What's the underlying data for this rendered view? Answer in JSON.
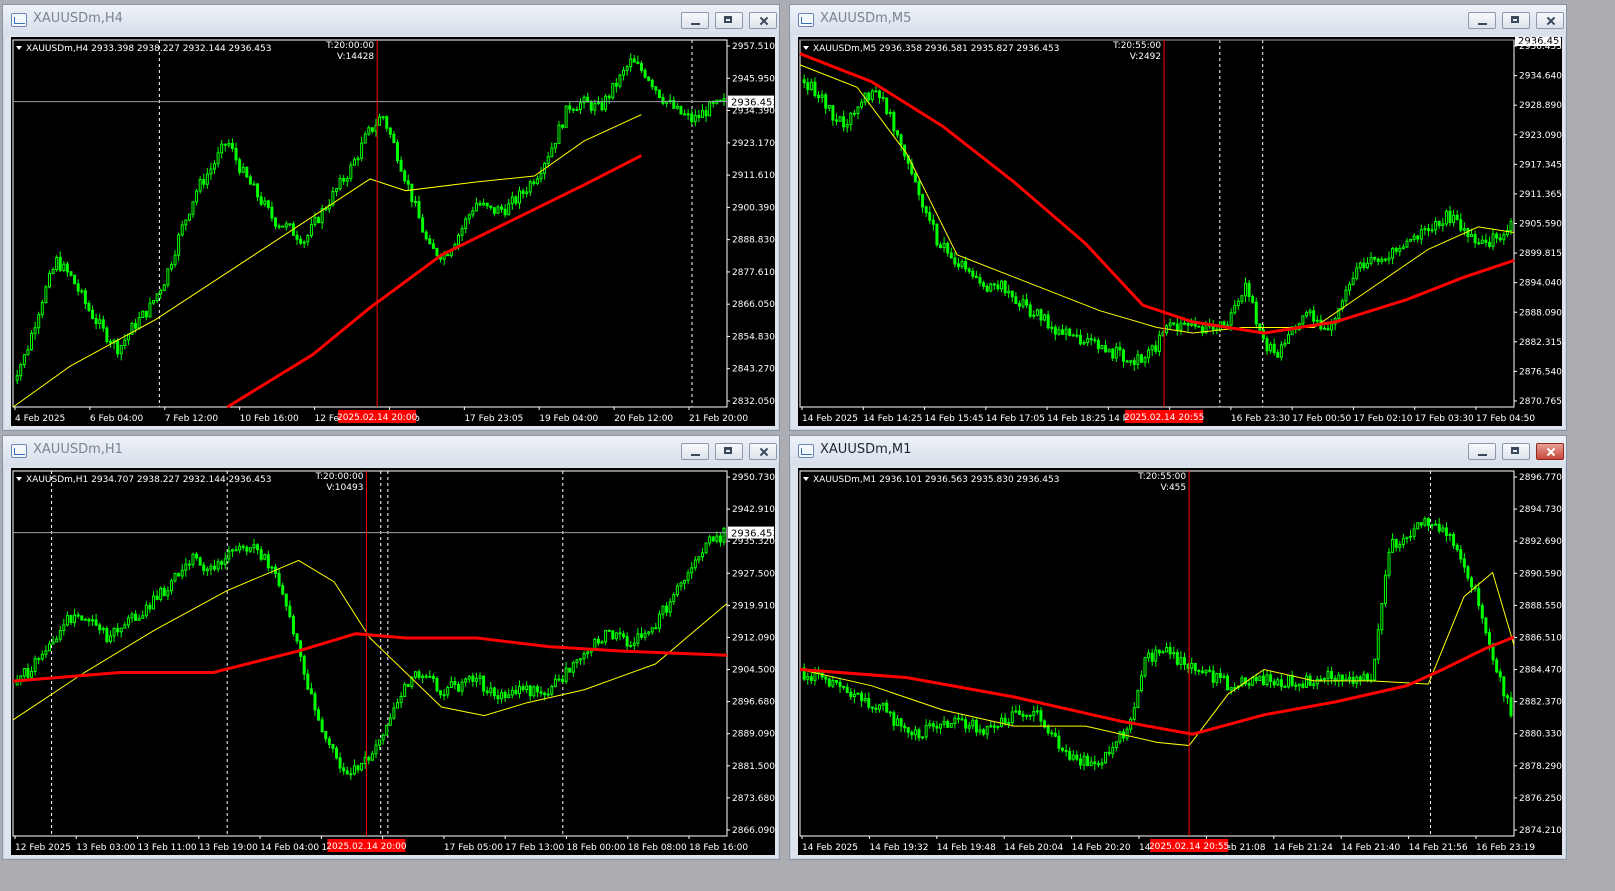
{
  "colors": {
    "bull": "#00ff00",
    "bear": "#00ff00",
    "ma_fast": "#ffff00",
    "ma_slow": "#ff0000",
    "crosshair": "#ff0000",
    "grid_separator": "#ffffff",
    "axis_text": "#ffffff"
  },
  "windows": [
    {
      "title": "XAUUSDm,H4",
      "active": false,
      "buttons": [
        "minimize",
        "maximize",
        "close"
      ],
      "chart_data": {
        "type": "candlestick",
        "symbol_line": "XAUUSDm,H4  2933.398 2938.227 2932.144 2936.453",
        "crosshair_time": "T:20:00:00",
        "crosshair_volume": "V:14428",
        "y_ticks": [
          "2957.510",
          "2945.950",
          "2934.390",
          "2923.170",
          "2911.610",
          "2900.390",
          "2888.830",
          "2877.610",
          "2866.050",
          "2854.830",
          "2843.270",
          "2832.050"
        ],
        "ylim": [
          2832.05,
          2957.51
        ],
        "x_ticks": [
          "4 Feb 2025",
          "6 Feb 04:00",
          "7 Feb 12:00",
          "10 Feb 16:00",
          "12 Feb 00:00",
          "13 Feb",
          "17 Feb 23:05",
          "19 Feb 04:00",
          "20 Feb 12:00",
          "21 Feb 20:00"
        ],
        "crosshair_date_label": "2025.02.14 20:00",
        "current_price": "2936.453",
        "close_path": [
          2840,
          2850,
          2868,
          2882,
          2876,
          2866,
          2858,
          2852,
          2860,
          2866,
          2876,
          2892,
          2906,
          2914,
          2923,
          2912,
          2904,
          2896,
          2893,
          2889,
          2898,
          2906,
          2914,
          2925,
          2932,
          2918,
          2902,
          2886,
          2884,
          2892,
          2902,
          2899,
          2900,
          2905,
          2912,
          2922,
          2935,
          2936,
          2934,
          2942,
          2950,
          2946,
          2938,
          2933,
          2930,
          2934,
          2936
        ],
        "crosshair_fraction": 0.51,
        "separator_fractions": [
          0.205,
          0.951
        ],
        "ma_fast": [
          [
            0,
            2832
          ],
          [
            0.08,
            2846
          ],
          [
            0.2,
            2862
          ],
          [
            0.35,
            2886
          ],
          [
            0.5,
            2910
          ],
          [
            0.55,
            2906
          ],
          [
            0.65,
            2909
          ],
          [
            0.73,
            2911
          ],
          [
            0.8,
            2923
          ],
          [
            0.88,
            2932
          ]
        ],
        "ma_slow": [
          [
            0.3,
            2832
          ],
          [
            0.42,
            2850
          ],
          [
            0.5,
            2866
          ],
          [
            0.6,
            2884
          ],
          [
            0.7,
            2896
          ],
          [
            0.8,
            2908
          ],
          [
            0.88,
            2918
          ]
        ]
      }
    },
    {
      "title": "XAUUSDm,M5",
      "active": false,
      "buttons": [
        "minimize",
        "maximize",
        "close"
      ],
      "chart_data": {
        "type": "candlestick",
        "symbol_line": "XAUUSDm,M5  2936.358 2936.581 2935.827 2936.453",
        "crosshair_time": "T:20:55:00",
        "crosshair_volume": "V:2492",
        "y_ticks": [
          "2936.453",
          "2934.640",
          "2928.890",
          "2923.090",
          "2917.345",
          "2911.365",
          "2905.590",
          "2899.815",
          "2894.040",
          "2888.090",
          "2882.315",
          "2876.540",
          "2870.765"
        ],
        "ylim": [
          2870.765,
          2936.453
        ],
        "x_ticks": [
          "14 Feb 2025",
          "14 Feb 14:25",
          "14 Feb 15:45",
          "14 Feb 17:05",
          "14 Feb 18:25",
          "14 Feb",
          "21:05",
          "16 Feb 23:30",
          "17 Feb 00:50",
          "17 Feb 02:10",
          "17 Feb 03:30",
          "17 Feb 04:50"
        ],
        "crosshair_date_label": "2025.02.14 20:55",
        "current_price": "2936.453",
        "close_path": [
          2930,
          2928,
          2924,
          2921,
          2925,
          2928,
          2923,
          2916,
          2908,
          2901,
          2897,
          2895,
          2892,
          2893,
          2890,
          2888,
          2886,
          2884,
          2883,
          2882,
          2881,
          2880,
          2879,
          2881,
          2886,
          2885,
          2884,
          2885,
          2887,
          2893,
          2882,
          2880,
          2885,
          2887,
          2884,
          2889,
          2895,
          2897,
          2898,
          2899,
          2901,
          2903,
          2905,
          2903,
          2900,
          2901,
          2903
        ],
        "crosshair_fraction": 0.51,
        "separator_fractions": [
          0.588,
          0.648
        ],
        "ma_fast": [
          [
            0,
            2932
          ],
          [
            0.08,
            2928
          ],
          [
            0.15,
            2916
          ],
          [
            0.22,
            2898
          ],
          [
            0.3,
            2894
          ],
          [
            0.42,
            2888
          ],
          [
            0.5,
            2885
          ],
          [
            0.55,
            2884
          ],
          [
            0.62,
            2885
          ],
          [
            0.72,
            2885
          ],
          [
            0.8,
            2892
          ],
          [
            0.88,
            2899
          ],
          [
            0.95,
            2903
          ],
          [
            1,
            2902
          ]
        ],
        "ma_slow": [
          [
            0,
            2934
          ],
          [
            0.1,
            2929
          ],
          [
            0.2,
            2921
          ],
          [
            0.3,
            2911
          ],
          [
            0.4,
            2900
          ],
          [
            0.48,
            2889
          ],
          [
            0.55,
            2886
          ],
          [
            0.65,
            2884
          ],
          [
            0.75,
            2886
          ],
          [
            0.85,
            2890
          ],
          [
            0.93,
            2894
          ],
          [
            1,
            2897
          ]
        ]
      }
    },
    {
      "title": "XAUUSDm,H1",
      "active": false,
      "buttons": [
        "minimize",
        "maximize",
        "close"
      ],
      "chart_data": {
        "type": "candlestick",
        "symbol_line": "XAUUSDm,H1  2934.707 2938.227 2932.144 2936.453",
        "crosshair_time": "T:20:00:00",
        "crosshair_volume": "V:10493",
        "y_ticks": [
          "2950.730",
          "2942.910",
          "2935.320",
          "2927.500",
          "2919.910",
          "2912.090",
          "2904.500",
          "2896.680",
          "2889.090",
          "2881.500",
          "2873.680",
          "2866.090"
        ],
        "ylim": [
          2866.09,
          2950.73
        ],
        "x_ticks": [
          "12 Feb 2025",
          "13 Feb 03:00",
          "13 Feb 11:00",
          "13 Feb 19:00",
          "14 Feb 04:00",
          "14 Feb",
          "00",
          "17 Feb 05:00",
          "17 Feb 13:00",
          "18 Feb 00:00",
          "18 Feb 08:00",
          "18 Feb 16:00"
        ],
        "crosshair_date_label": "2025.02.14 20:00",
        "current_price": "2936.453",
        "close_path": [
          2900,
          2904,
          2908,
          2914,
          2918,
          2916,
          2912,
          2916,
          2918,
          2922,
          2926,
          2930,
          2928,
          2930,
          2934,
          2932,
          2926,
          2915,
          2900,
          2888,
          2882,
          2881,
          2886,
          2894,
          2902,
          2904,
          2900,
          2901,
          2903,
          2899,
          2898,
          2900,
          2899,
          2902,
          2906,
          2910,
          2913,
          2911,
          2912,
          2916,
          2922,
          2928,
          2934,
          2936
        ],
        "crosshair_fraction": 0.495,
        "separator_fractions": [
          0.054,
          0.3,
          0.515,
          0.525,
          0.77
        ],
        "ma_fast": [
          [
            0,
            2893
          ],
          [
            0.1,
            2904
          ],
          [
            0.2,
            2914
          ],
          [
            0.3,
            2923
          ],
          [
            0.4,
            2930
          ],
          [
            0.45,
            2925
          ],
          [
            0.5,
            2912
          ],
          [
            0.6,
            2896
          ],
          [
            0.66,
            2894
          ],
          [
            0.72,
            2897
          ],
          [
            0.8,
            2900
          ],
          [
            0.9,
            2906
          ],
          [
            1,
            2920
          ]
        ],
        "ma_slow": [
          [
            0,
            2902
          ],
          [
            0.15,
            2904
          ],
          [
            0.28,
            2904
          ],
          [
            0.4,
            2909
          ],
          [
            0.48,
            2913
          ],
          [
            0.55,
            2912
          ],
          [
            0.65,
            2912
          ],
          [
            0.75,
            2910
          ],
          [
            0.85,
            2909
          ],
          [
            1,
            2908
          ]
        ]
      }
    },
    {
      "title": "XAUUSDm,M1",
      "active": true,
      "buttons": [
        "minimize",
        "maximize",
        "close"
      ],
      "chart_data": {
        "type": "candlestick",
        "symbol_line": "XAUUSDm,M1  2936.101 2936.563 2935.830 2936.453",
        "crosshair_time": "T:20:55:00",
        "crosshair_volume": "V:455",
        "y_ticks": [
          "2896.770",
          "2894.730",
          "2892.690",
          "2890.590",
          "2888.550",
          "2886.510",
          "2884.470",
          "2882.370",
          "2880.330",
          "2878.290",
          "2876.250",
          "2874.210"
        ],
        "ylim": [
          2874.21,
          2896.77
        ],
        "x_ticks": [
          "14 Feb 2025",
          "14 Feb 19:32",
          "14 Feb 19:48",
          "14 Feb 20:04",
          "14 Feb 20:20",
          "14 Feb 2",
          "14 Feb 21:08",
          "14 Feb 21:24",
          "14 Feb 21:40",
          "14 Feb 21:56",
          "16 Feb 23:19"
        ],
        "crosshair_date_label": "2025.02.14 20:55",
        "current_price": "2936.453",
        "close_path": [
          2884.5,
          2884,
          2883.5,
          2883,
          2882.5,
          2882,
          2881,
          2880.5,
          2881,
          2881.2,
          2881,
          2880.8,
          2881.5,
          2882,
          2881.5,
          2880,
          2879,
          2878.5,
          2879.5,
          2881,
          2885,
          2886,
          2885,
          2884.5,
          2884,
          2883.5,
          2883.8,
          2884,
          2883.8,
          2883.6,
          2884,
          2884.2,
          2883.8,
          2884,
          2892,
          2893,
          2893.5,
          2893,
          2892,
          2889,
          2885,
          2882
        ],
        "crosshair_fraction": 0.545,
        "separator_fractions": [
          0.883
        ],
        "ma_fast": [
          [
            0,
            2884.5
          ],
          [
            0.1,
            2883.5
          ],
          [
            0.2,
            2882
          ],
          [
            0.3,
            2881
          ],
          [
            0.4,
            2881
          ],
          [
            0.5,
            2880
          ],
          [
            0.545,
            2879.8
          ],
          [
            0.6,
            2883
          ],
          [
            0.65,
            2884.5
          ],
          [
            0.72,
            2883.8
          ],
          [
            0.8,
            2883.8
          ],
          [
            0.88,
            2883.6
          ],
          [
            0.93,
            2889
          ],
          [
            0.97,
            2890.5
          ],
          [
            1,
            2886
          ]
        ],
        "ma_slow": [
          [
            0,
            2884.5
          ],
          [
            0.15,
            2884
          ],
          [
            0.3,
            2882.8
          ],
          [
            0.45,
            2881.3
          ],
          [
            0.55,
            2880.5
          ],
          [
            0.65,
            2881.7
          ],
          [
            0.75,
            2882.5
          ],
          [
            0.85,
            2883.5
          ],
          [
            0.9,
            2884.5
          ],
          [
            0.96,
            2885.8
          ],
          [
            1,
            2886.5
          ]
        ]
      }
    }
  ]
}
